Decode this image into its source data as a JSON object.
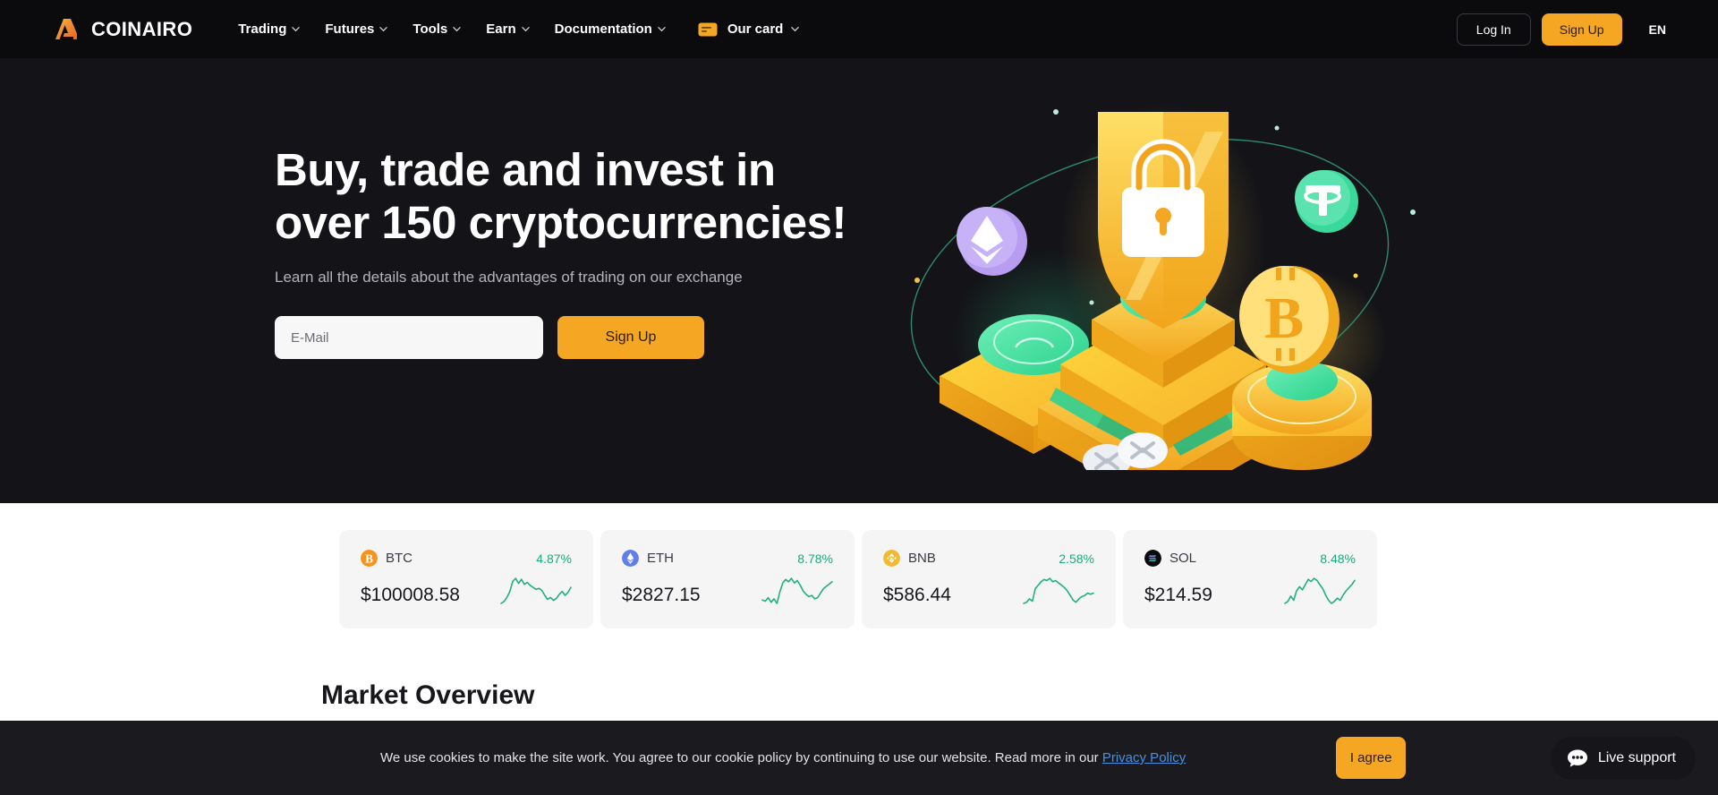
{
  "brand": {
    "name": "COINAIRO",
    "logo_icon": "coinairo-logo-icon",
    "accent": "#f5a623"
  },
  "header": {
    "nav": [
      {
        "label": "Trading",
        "icon": "chevron-down-icon"
      },
      {
        "label": "Futures",
        "icon": "chevron-down-icon"
      },
      {
        "label": "Tools",
        "icon": "chevron-down-icon"
      },
      {
        "label": "Earn",
        "icon": "chevron-down-icon"
      },
      {
        "label": "Documentation",
        "icon": "chevron-down-icon"
      },
      {
        "label": "Our card",
        "icon": "chevron-down-icon",
        "lead_icon": "credit-card-icon"
      }
    ],
    "login_label": "Log In",
    "signup_label": "Sign Up",
    "language": "EN"
  },
  "hero": {
    "title": "Buy, trade and invest in over 150 cryptocurrencies!",
    "subtitle": "Learn all the details about the advantages of trading on our exchange",
    "email_placeholder": "E-Mail",
    "email_value": "",
    "signup_label": "Sign Up",
    "illustration": "crypto-vault-shield-illustration"
  },
  "tickers": [
    {
      "symbol": "BTC",
      "icon": "bitcoin-icon",
      "icon_color": "#f7931a",
      "change": "4.87%",
      "price": "$100008.58",
      "trend": "up",
      "spark": [
        30,
        28,
        24,
        18,
        8,
        5,
        10,
        6,
        11,
        9,
        12,
        14,
        16,
        15,
        17,
        22,
        26,
        24,
        27,
        25,
        21,
        18,
        22,
        19,
        14
      ]
    },
    {
      "symbol": "ETH",
      "icon": "ethereum-icon",
      "icon_color": "#627eea",
      "change": "8.78%",
      "price": "$2827.15",
      "trend": "up",
      "spark": [
        24,
        25,
        22,
        26,
        23,
        27,
        17,
        9,
        6,
        8,
        5,
        9,
        7,
        11,
        16,
        19,
        21,
        20,
        23,
        22,
        18,
        14,
        12,
        10,
        8
      ]
    },
    {
      "symbol": "BNB",
      "icon": "bnb-icon",
      "icon_color": "#f3ba2f",
      "change": "2.58%",
      "price": "$586.44",
      "trend": "up",
      "spark": [
        27,
        26,
        23,
        25,
        14,
        11,
        8,
        6,
        7,
        5,
        8,
        7,
        9,
        11,
        13,
        16,
        20,
        24,
        26,
        23,
        21,
        20,
        18,
        19,
        18
      ]
    },
    {
      "symbol": "SOL",
      "icon": "solana-icon",
      "icon_color": "#14f195",
      "change": "8.48%",
      "price": "$214.59",
      "trend": "up",
      "spark": [
        27,
        25,
        20,
        24,
        15,
        11,
        14,
        9,
        4,
        6,
        3,
        5,
        9,
        13,
        19,
        24,
        27,
        25,
        22,
        24,
        19,
        15,
        12,
        9,
        5
      ]
    }
  ],
  "market": {
    "heading": "Market Overview"
  },
  "cookie": {
    "text": "We use cookies to make the site work. You agree to our cookie policy by continuing to use our website. Read more in our ",
    "link_label": "Privacy Policy",
    "agree_label": "I agree"
  },
  "live_support": {
    "label": "Live support",
    "icon": "chat-bubble-icon"
  },
  "colors": {
    "accent": "#f5a623",
    "positive": "#1fa97f",
    "link": "#4a90e2",
    "header_bg": "#0b0b0e",
    "hero_bg": "#141418"
  }
}
